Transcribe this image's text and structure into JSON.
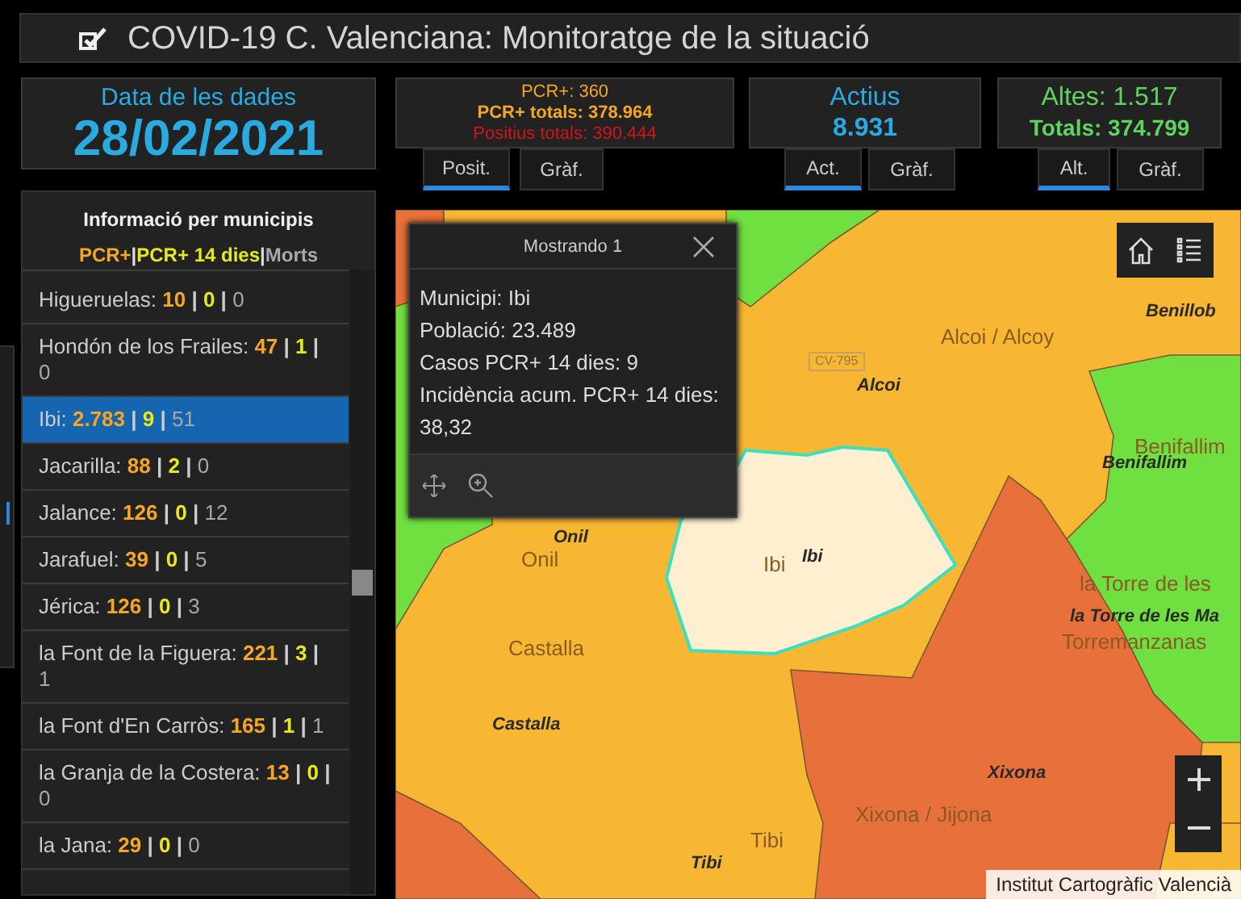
{
  "window": {
    "title": "COVID-19 C. Valenciana: Monitoratge de la situació"
  },
  "date_card": {
    "label": "Data de les dades",
    "value": "28/02/2021"
  },
  "positius_card": {
    "lines": [
      {
        "text": "PCR+: 360",
        "color": "#f5a623",
        "bold": false
      },
      {
        "text": "PCR+ totals: 378.964",
        "color": "#f5a623",
        "bold": true
      },
      {
        "text": "Positius totals: 390.444",
        "color": "#d0161b",
        "bold": false
      }
    ],
    "tabs": [
      {
        "label": "Posit.",
        "selected": true
      },
      {
        "label": "Gràf.",
        "selected": false
      }
    ]
  },
  "actius_card": {
    "label": "Actius",
    "value": "8.931",
    "tabs": [
      {
        "label": "Act.",
        "selected": true
      },
      {
        "label": "Gràf.",
        "selected": false
      }
    ]
  },
  "altes_card": {
    "label": "Altes: 1.517",
    "value": "Totals: 374.799",
    "tabs": [
      {
        "label": "Alt.",
        "selected": true
      },
      {
        "label": "Gràf.",
        "selected": false
      }
    ]
  },
  "municipis": {
    "title": "Informació per municipis",
    "separator": "|",
    "legend": [
      {
        "text": "PCR+",
        "color": "#f5a623"
      },
      {
        "text": "PCR+ 14 dies",
        "color": "#e8e81c"
      },
      {
        "text": "Morts",
        "color": "#a8a8a8"
      }
    ],
    "items": [
      {
        "name": "Higueruelas:",
        "values": [
          "10",
          "0",
          "0"
        ],
        "selected": false
      },
      {
        "name": "Hondón de los Frailes:",
        "values": [
          "47",
          "1",
          "0"
        ],
        "selected": false
      },
      {
        "name": "Ibi:",
        "values": [
          "2.783",
          "9",
          "51"
        ],
        "selected": true
      },
      {
        "name": "Jacarilla:",
        "values": [
          "88",
          "2",
          "0"
        ],
        "selected": false
      },
      {
        "name": "Jalance:",
        "values": [
          "126",
          "0",
          "12"
        ],
        "selected": false
      },
      {
        "name": "Jarafuel:",
        "values": [
          "39",
          "0",
          "5"
        ],
        "selected": false
      },
      {
        "name": "Jérica:",
        "values": [
          "126",
          "0",
          "3"
        ],
        "selected": false
      },
      {
        "name": "la Font de la Figuera:",
        "values": [
          "221",
          "3",
          "1"
        ],
        "selected": false
      },
      {
        "name": "la Font d'En Carròs:",
        "values": [
          "165",
          "1",
          "1"
        ],
        "selected": false
      },
      {
        "name": "la Granja de la Costera:",
        "values": [
          "13",
          "0",
          "0"
        ],
        "selected": false
      },
      {
        "name": "la Jana:",
        "values": [
          "29",
          "0",
          "0"
        ],
        "selected": false
      }
    ]
  },
  "map": {
    "labels": [
      {
        "text": "Alcoi / Alcoy",
        "kind": "area"
      },
      {
        "text": "CV-795",
        "kind": "road"
      },
      {
        "text": "Alcoi",
        "kind": "town"
      },
      {
        "text": "Benillob",
        "kind": "town"
      },
      {
        "text": "Benifallim",
        "kind": "area"
      },
      {
        "text": "Benifallim",
        "kind": "town"
      },
      {
        "text": "la Torre de les",
        "kind": "area"
      },
      {
        "text": "la Torre de les Ma",
        "kind": "town"
      },
      {
        "text": "Torremanzanas",
        "kind": "area"
      },
      {
        "text": "Onil",
        "kind": "town"
      },
      {
        "text": "Onil",
        "kind": "area"
      },
      {
        "text": "Ibi",
        "kind": "area"
      },
      {
        "text": "Ibi",
        "kind": "town"
      },
      {
        "text": "Castalla",
        "kind": "area"
      },
      {
        "text": "Castalla",
        "kind": "town"
      },
      {
        "text": "Xixona",
        "kind": "town"
      },
      {
        "text": "Xixona / Jijona",
        "kind": "area"
      },
      {
        "text": "Tibi",
        "kind": "area"
      },
      {
        "text": "Tibi",
        "kind": "town"
      }
    ],
    "attribution": "Institut Cartogràfic Valencià",
    "popup": {
      "title": "Mostrando 1",
      "lines": [
        "Municipi: Ibi",
        "Població: 23.489",
        "Casos PCR+ 14 dies: 9",
        "Incidència acum. PCR+ 14 dies: 38,32"
      ]
    }
  }
}
